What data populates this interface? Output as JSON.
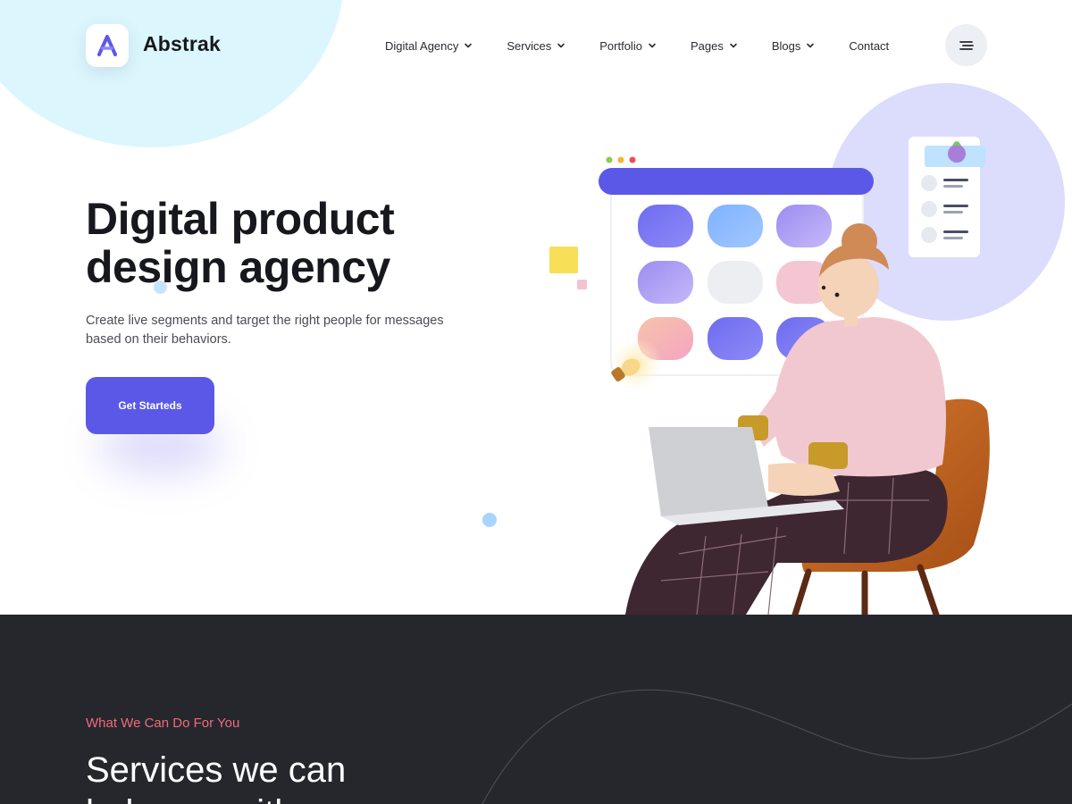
{
  "brand": {
    "name": "Abstrak",
    "logo_icon": "abstrak-logo-icon",
    "accent": "#5b58e8"
  },
  "nav": {
    "items": [
      {
        "label": "Digital Agency",
        "has_dropdown": true
      },
      {
        "label": "Services",
        "has_dropdown": true
      },
      {
        "label": "Portfolio",
        "has_dropdown": true
      },
      {
        "label": "Pages",
        "has_dropdown": true
      },
      {
        "label": "Blogs",
        "has_dropdown": true
      },
      {
        "label": "Contact",
        "has_dropdown": false
      }
    ],
    "menu_icon": "hamburger-menu-icon"
  },
  "hero": {
    "title_line1": "Digital product",
    "title_line2": "design agency",
    "description_line1": "Create live segments and target the right people for messages",
    "description_line2": "based on their behaviors.",
    "cta_label": "Get Starteds",
    "illustration": "woman-with-laptop-on-chair-illustration"
  },
  "services": {
    "kicker": "What We Can Do For You",
    "title_line1": "Services we can",
    "title_line2": "help you with",
    "kicker_color": "#ef6a7e",
    "background": "#26272c"
  }
}
